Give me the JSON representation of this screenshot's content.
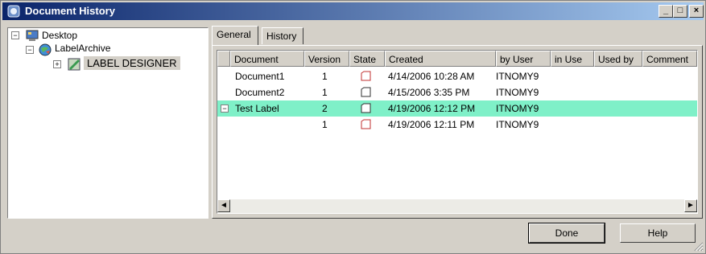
{
  "window": {
    "title": "Document History"
  },
  "title_buttons": {
    "minimize": "_",
    "maximize": "□",
    "close": "×"
  },
  "tree": {
    "nodes": [
      {
        "label": "Desktop",
        "expander": "−"
      },
      {
        "label": "LabelArchive",
        "expander": "−"
      },
      {
        "label": "LABEL DESIGNER",
        "expander": "+"
      }
    ]
  },
  "tabs": [
    {
      "label": "General"
    },
    {
      "label": "History"
    }
  ],
  "list": {
    "columns": [
      "Document",
      "Version",
      "State",
      "Created",
      "by User",
      "in Use",
      "Used by",
      "Comment"
    ],
    "rows": [
      {
        "document": "Document1",
        "version": "1",
        "created": "4/14/2006 10:28 AM",
        "by_user": "ITNOMY9",
        "selected": false
      },
      {
        "document": "Document2",
        "version": "1",
        "created": "4/15/2006 3:35 PM",
        "by_user": "ITNOMY9",
        "selected": false
      },
      {
        "document": "Test Label",
        "version": "2",
        "created": "4/19/2006 12:12 PM",
        "by_user": "ITNOMY9",
        "selected": true
      },
      {
        "document": "",
        "version": "1",
        "created": "4/19/2006 12:11 PM",
        "by_user": "ITNOMY9",
        "selected": false
      }
    ],
    "scroll": {
      "left": "◄",
      "right": "►"
    }
  },
  "buttons": {
    "done": "Done",
    "help": "Help"
  },
  "colors": {
    "title_start": "#0a246a",
    "title_end": "#a6caf0",
    "selected_row": "#7ff0c8",
    "face": "#d4d0c8"
  }
}
